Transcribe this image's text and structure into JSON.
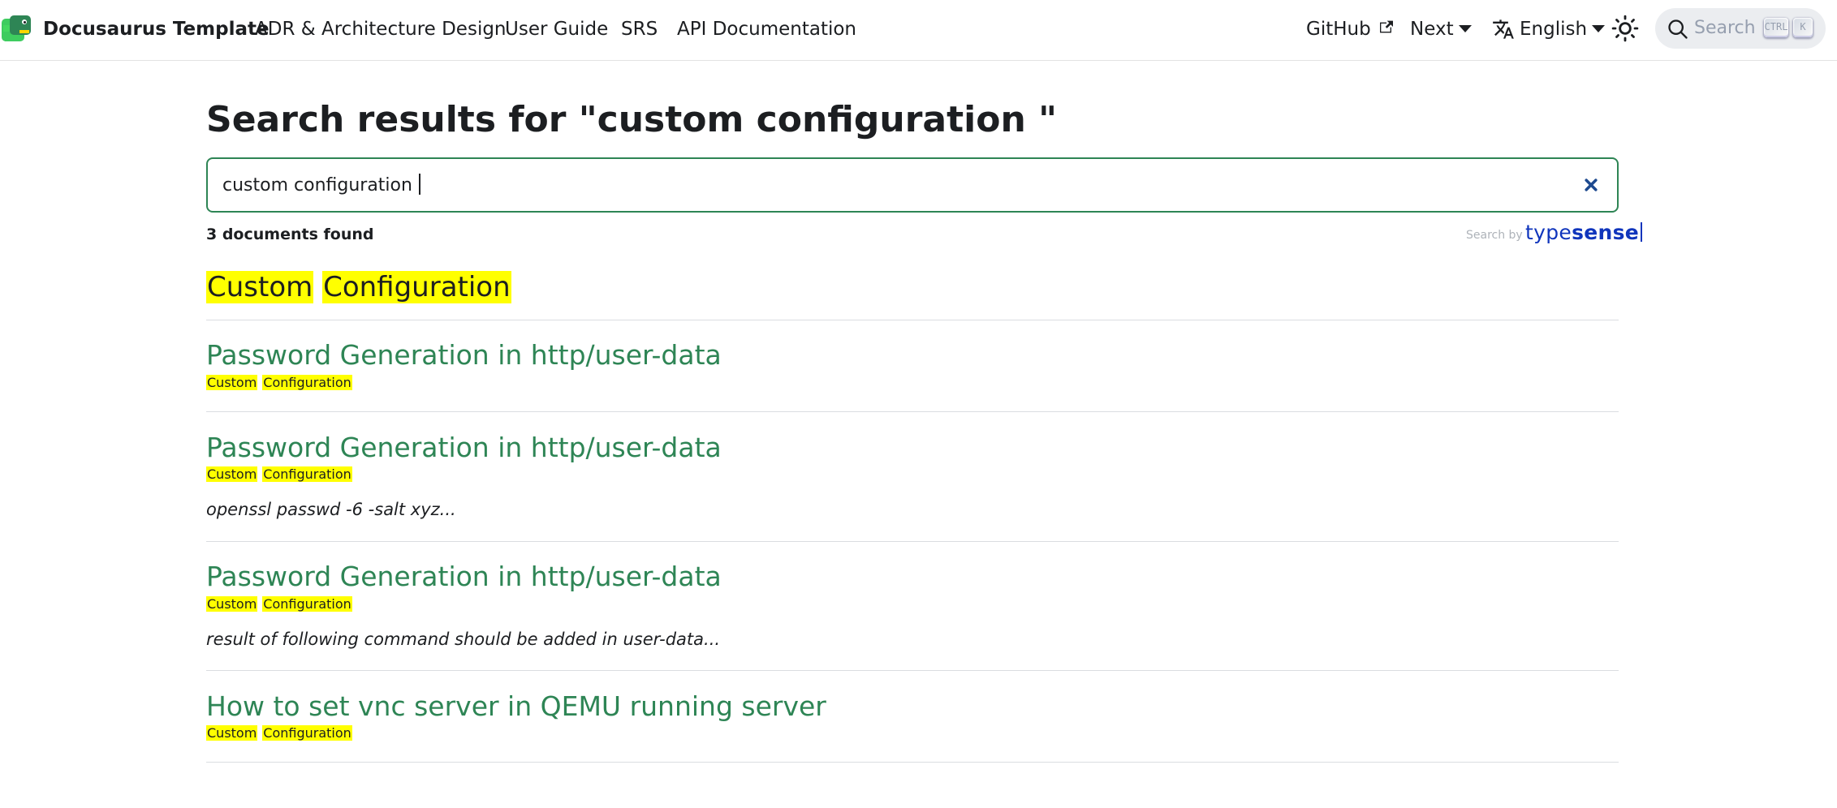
{
  "navbar": {
    "brand": "Docusaurus Template",
    "links": [
      {
        "label": "ADR & Architecture Design"
      },
      {
        "label": "User Guide"
      },
      {
        "label": "SRS"
      },
      {
        "label": "API Documentation"
      }
    ],
    "github_label": "GitHub",
    "version_label": "Next",
    "language_label": "English",
    "search_placeholder": "Search",
    "search_keys": [
      "CTRL",
      "K"
    ]
  },
  "main": {
    "title": "Search results for \"custom configuration \"",
    "search_value": "custom configuration ",
    "count_text": "3 documents found",
    "powered_by_prefix": "Search by",
    "powered_by_brand_1": "type",
    "powered_by_brand_2": "sense",
    "section": {
      "word1": "Custom",
      "word2": "Configuration"
    },
    "results": [
      {
        "title": "Password Generation in http/user-data",
        "crumb1": "Custom",
        "crumb2": "Configuration",
        "preview": ""
      },
      {
        "title": "Password Generation in http/user-data",
        "crumb1": "Custom",
        "crumb2": "Configuration",
        "preview": "openssl passwd -6 -salt xyz..."
      },
      {
        "title": "Password Generation in http/user-data",
        "crumb1": "Custom",
        "crumb2": "Configuration",
        "preview": "result of following command should be added in user-data..."
      },
      {
        "title": "How to set vnc server in QEMU running server",
        "crumb1": "Custom",
        "crumb2": "Configuration",
        "preview": ""
      }
    ]
  },
  "colors": {
    "primary": "#2e8555",
    "highlight": "#ffff00",
    "typesense": "#1035bc"
  }
}
